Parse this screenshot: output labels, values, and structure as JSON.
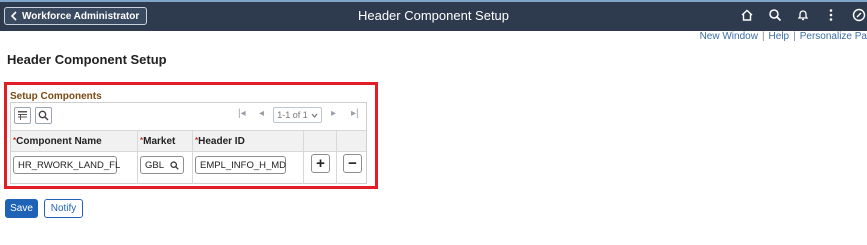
{
  "header": {
    "back_label": "Workforce Administrator",
    "title": "Header Component Setup",
    "icons": [
      "home-icon",
      "search-icon",
      "bell-icon",
      "more-icon",
      "nav-icon"
    ]
  },
  "links": {
    "new_window": "New Window",
    "help": "Help",
    "personalize": "Personalize Pa"
  },
  "page_title": "Header Component Setup",
  "section": {
    "label": "Setup Components",
    "pager": {
      "first": "|◂",
      "prev": "◂",
      "selected": "1-1 of 1",
      "next": "▸",
      "last": "▸|"
    },
    "columns": [
      {
        "label": "Component Name",
        "required": true
      },
      {
        "label": "Market",
        "required": true
      },
      {
        "label": "Header ID",
        "required": true
      }
    ],
    "rows": [
      {
        "component_name": "HR_RWORK_LAND_FL",
        "market": "GBL",
        "header_id": "EMPL_INFO_H_MD"
      }
    ],
    "add_label": "+",
    "delete_label": "−"
  },
  "buttons": {
    "save": "Save",
    "notify": "Notify"
  },
  "colors": {
    "topbar": "#2e3b4e",
    "highlight": "#e21d25",
    "primary": "#1f63b6",
    "section_label": "#7a4a12"
  }
}
